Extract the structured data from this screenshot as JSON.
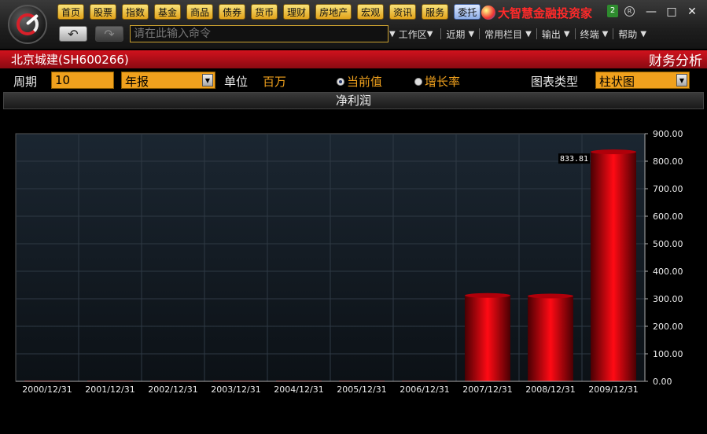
{
  "toolbar": {
    "nav": [
      "首页",
      "股票",
      "指数",
      "基金",
      "商品",
      "债券",
      "货币",
      "理财",
      "房地产",
      "宏观",
      "资讯",
      "服务"
    ],
    "trust": "委托",
    "brand": "大智慧金融投资家",
    "badge": "2",
    "reg_mark": "R",
    "command_placeholder": "请在此输入命令",
    "menus": [
      "工作区",
      "近期",
      "常用栏目",
      "输出",
      "终端",
      "帮助"
    ],
    "back_label": "↶",
    "forward_label": "↷"
  },
  "window": {
    "minimize": "—",
    "maximize": "□",
    "close": "✕"
  },
  "header": {
    "stock": "北京城建(SH600266)",
    "module": "财务分析"
  },
  "controls": {
    "period_label": "周期",
    "period_value": "10",
    "report_type": "年报",
    "unit_label": "单位",
    "unit_value": "百万",
    "radio_current": "当前值",
    "radio_growth": "增长率",
    "selected_radio": "current",
    "charttype_label": "图表类型",
    "charttype_value": "柱状图"
  },
  "chart_data": {
    "type": "bar",
    "title": "净利润",
    "categories": [
      "2000/12/31",
      "2001/12/31",
      "2002/12/31",
      "2003/12/31",
      "2004/12/31",
      "2005/12/31",
      "2006/12/31",
      "2007/12/31",
      "2008/12/31",
      "2009/12/31"
    ],
    "values": [
      0,
      0,
      0,
      0,
      0,
      0,
      0,
      312,
      310,
      833.81
    ],
    "ylim": [
      0,
      900
    ],
    "yticks": [
      "0.00",
      "100.00",
      "200.00",
      "300.00",
      "400.00",
      "500.00",
      "600.00",
      "700.00",
      "800.00",
      "900.00"
    ],
    "annotation": {
      "category": "2009/12/31",
      "text": "833.81"
    },
    "grid": true,
    "yaxis_side": "right",
    "colors": {
      "bar": "#e0000a",
      "background": "#16202a",
      "grid": "#2e3944"
    }
  }
}
